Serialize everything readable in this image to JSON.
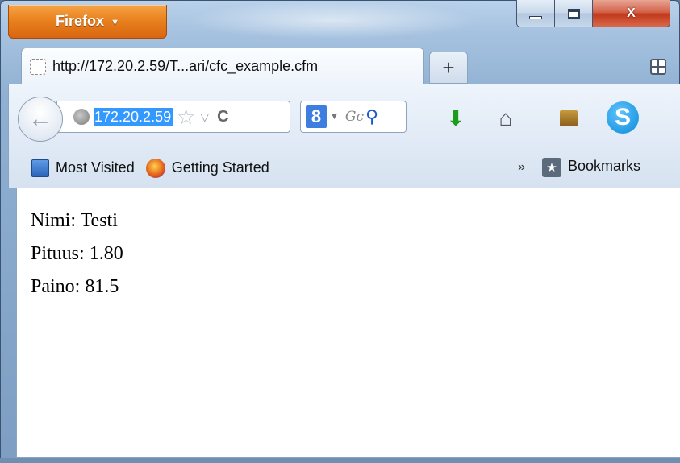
{
  "app_button": {
    "label": "Firefox",
    "caret": "▼"
  },
  "window_controls": {
    "minimize": "",
    "maximize": "",
    "close": "X"
  },
  "tab": {
    "title": "http://172.20.2.59/T...ari/cfc_example.cfm"
  },
  "new_tab": {
    "label": "+"
  },
  "navbar": {
    "back_icon": "←",
    "url": "172.20.2.59",
    "star_icon": "☆",
    "dropdown_icon": "▽",
    "reload_icon": "C",
    "search_engine_icon": "8",
    "search_placeholder": "Gc",
    "search_icon": "⚲"
  },
  "toolbar_icons": {
    "download": "⬇",
    "home": "⌂",
    "skype": "S"
  },
  "bookmarks_bar": {
    "most_visited": "Most Visited",
    "getting_started": "Getting Started",
    "overflow": "»",
    "bookmarks": "Bookmarks"
  },
  "page": {
    "lines": [
      "Nimi: Testi",
      "Pituus: 1.80",
      "Paino: 81.5"
    ]
  },
  "colors": {
    "firefox_orange": "#e9821f",
    "close_red": "#c23a1c",
    "url_selection": "#3399ff",
    "download_green": "#1a9d1a",
    "skype_blue": "#0a8ad8"
  }
}
